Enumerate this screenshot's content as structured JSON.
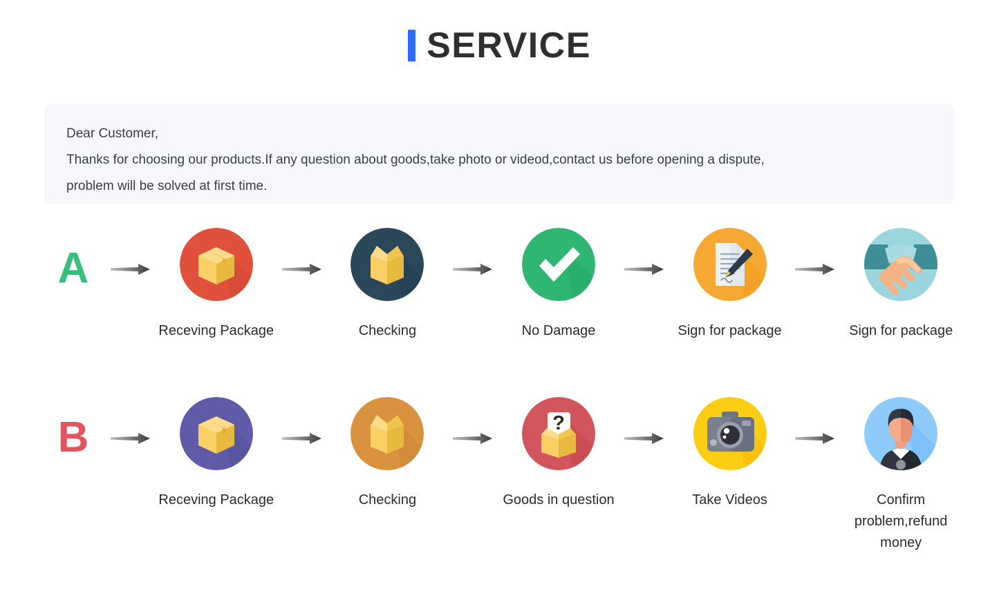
{
  "header": {
    "accent_color": "#2f6bfa",
    "title": "SERVICE"
  },
  "notice": {
    "lines": [
      "Dear Customer,",
      "Thanks for choosing our products.If any question about goods,take photo or videod,contact us before opening a dispute,",
      "problem will be solved at first time."
    ],
    "background": "#f5f7fa"
  },
  "flows": [
    {
      "badge": "A",
      "badge_color": "#35c07d",
      "steps": [
        {
          "label": "Receving Package",
          "icon": "closed-box-icon",
          "circle_color": "#e0503c",
          "shadow_color": "#c8412f"
        },
        {
          "label": "Checking",
          "icon": "open-box-icon",
          "circle_color": "#2b485b",
          "shadow_color": "#1f3645"
        },
        {
          "label": "No Damage",
          "icon": "check-mark-icon",
          "circle_color": "#2fb673",
          "shadow_color": "#1f9b5d"
        },
        {
          "label": "Sign for package",
          "icon": "sign-document-icon",
          "circle_color": "#f5a832",
          "shadow_color": "#eb9510"
        },
        {
          "label": "Sign for package",
          "icon": "handshake-icon",
          "circle_color": "#9bd6dd",
          "shadow_color": "#9bd6dd"
        }
      ]
    },
    {
      "badge": "B",
      "badge_color": "#e0555f",
      "steps": [
        {
          "label": "Receving Package",
          "icon": "closed-box-icon",
          "circle_color": "#5f5ba8",
          "shadow_color": "#4e4a90"
        },
        {
          "label": "Checking",
          "icon": "open-box-icon",
          "circle_color": "#d9933f",
          "shadow_color": "#c57f2c"
        },
        {
          "label": "Goods in question",
          "icon": "question-box-icon",
          "circle_color": "#d2545c",
          "shadow_color": "#bc424b"
        },
        {
          "label": "Take Videos",
          "icon": "camera-icon",
          "circle_color": "#fccd12",
          "shadow_color": "#f9a400"
        },
        {
          "label": "Confirm problem,refund money",
          "icon": "person-support-icon",
          "circle_color": "#8fcafc",
          "shadow_color": "#5aa8f5"
        }
      ]
    }
  ],
  "arrow": {
    "name": "arrow-right-icon",
    "color": "#4a4a4a"
  }
}
